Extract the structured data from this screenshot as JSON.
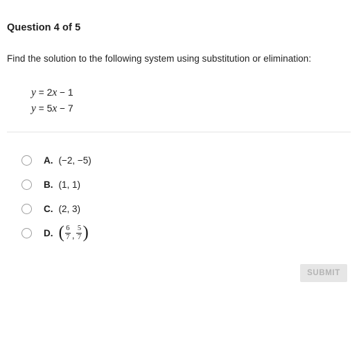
{
  "question": {
    "title": "Question 4 of 5",
    "prompt": "Find the solution to the following system using substitution or elimination:",
    "equations": [
      {
        "lhs": "y",
        "eq": "=",
        "coef": "2",
        "var": "x",
        "op": "−",
        "const": "1"
      },
      {
        "lhs": "y",
        "eq": "=",
        "coef": "5",
        "var": "x",
        "op": "−",
        "const": "7"
      }
    ]
  },
  "options": [
    {
      "letter": "A.",
      "text": "(−2, −5)",
      "type": "plain",
      "selected": false
    },
    {
      "letter": "B.",
      "text": "(1, 1)",
      "type": "plain",
      "selected": false
    },
    {
      "letter": "C.",
      "text": "(2, 3)",
      "type": "plain",
      "selected": false
    },
    {
      "letter": "D.",
      "type": "fraction-pair",
      "open_paren": "(",
      "close_paren": ")",
      "comma": ",",
      "first": {
        "numerator": "6",
        "denominator": "7"
      },
      "second": {
        "numerator": "5",
        "denominator": "7"
      },
      "selected": false
    }
  ],
  "actions": {
    "submit_label": "SUBMIT",
    "submit_enabled": false
  },
  "colors": {
    "text": "#1d1d1d",
    "divider": "#e4e4e4",
    "radio_border": "#9e9e9e",
    "submit_background": "#e6e6e6",
    "submit_text": "#b4b4b4",
    "page_background": "#ffffff"
  }
}
